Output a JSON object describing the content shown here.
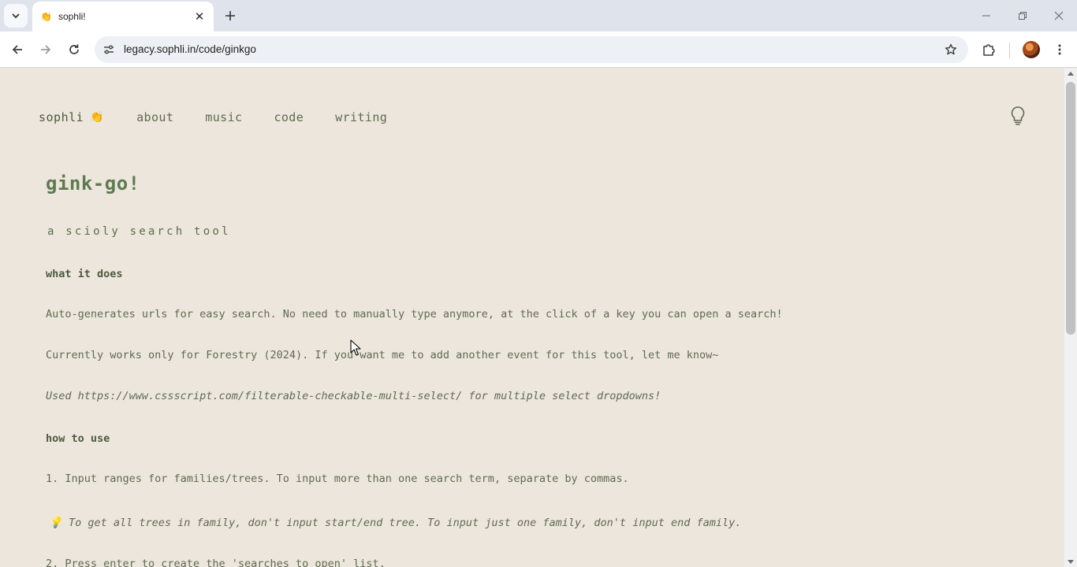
{
  "browser": {
    "tab_title": "sophli!",
    "tab_favicon": "👏",
    "url": "legacy.sophli.in/code/ginkgo"
  },
  "site_nav": {
    "brand": "sophli",
    "brand_emoji": "👏",
    "links": [
      "about",
      "music",
      "code",
      "writing"
    ],
    "theme_toggle_icon": "lightbulb-icon"
  },
  "content": {
    "title": "gink-go!",
    "subtitle": "a scioly search tool",
    "section1_heading": "what it does",
    "p1": "Auto-generates urls for easy search. No need to manually type anymore, at the click of a key you can open a search!",
    "p2": "Currently works only for Forestry (2024). If you want me to add another event for this tool, let me know~",
    "p3": "Used https://www.cssscript.com/filterable-checkable-multi-select/ for multiple select dropdowns!",
    "section2_heading": "how to use",
    "step1": "1. Input ranges for families/trees. To input more than one search term, separate by commas.",
    "tip_emoji": "💡",
    "tip": "To get all trees in family, don't input start/end tree. To input just one family, don't input end family.",
    "step2": "2. Press enter to create the 'searches to open' list."
  },
  "colors": {
    "page_bg": "#ede6dc",
    "text": "#5e6b50",
    "title": "#5e7a50"
  }
}
